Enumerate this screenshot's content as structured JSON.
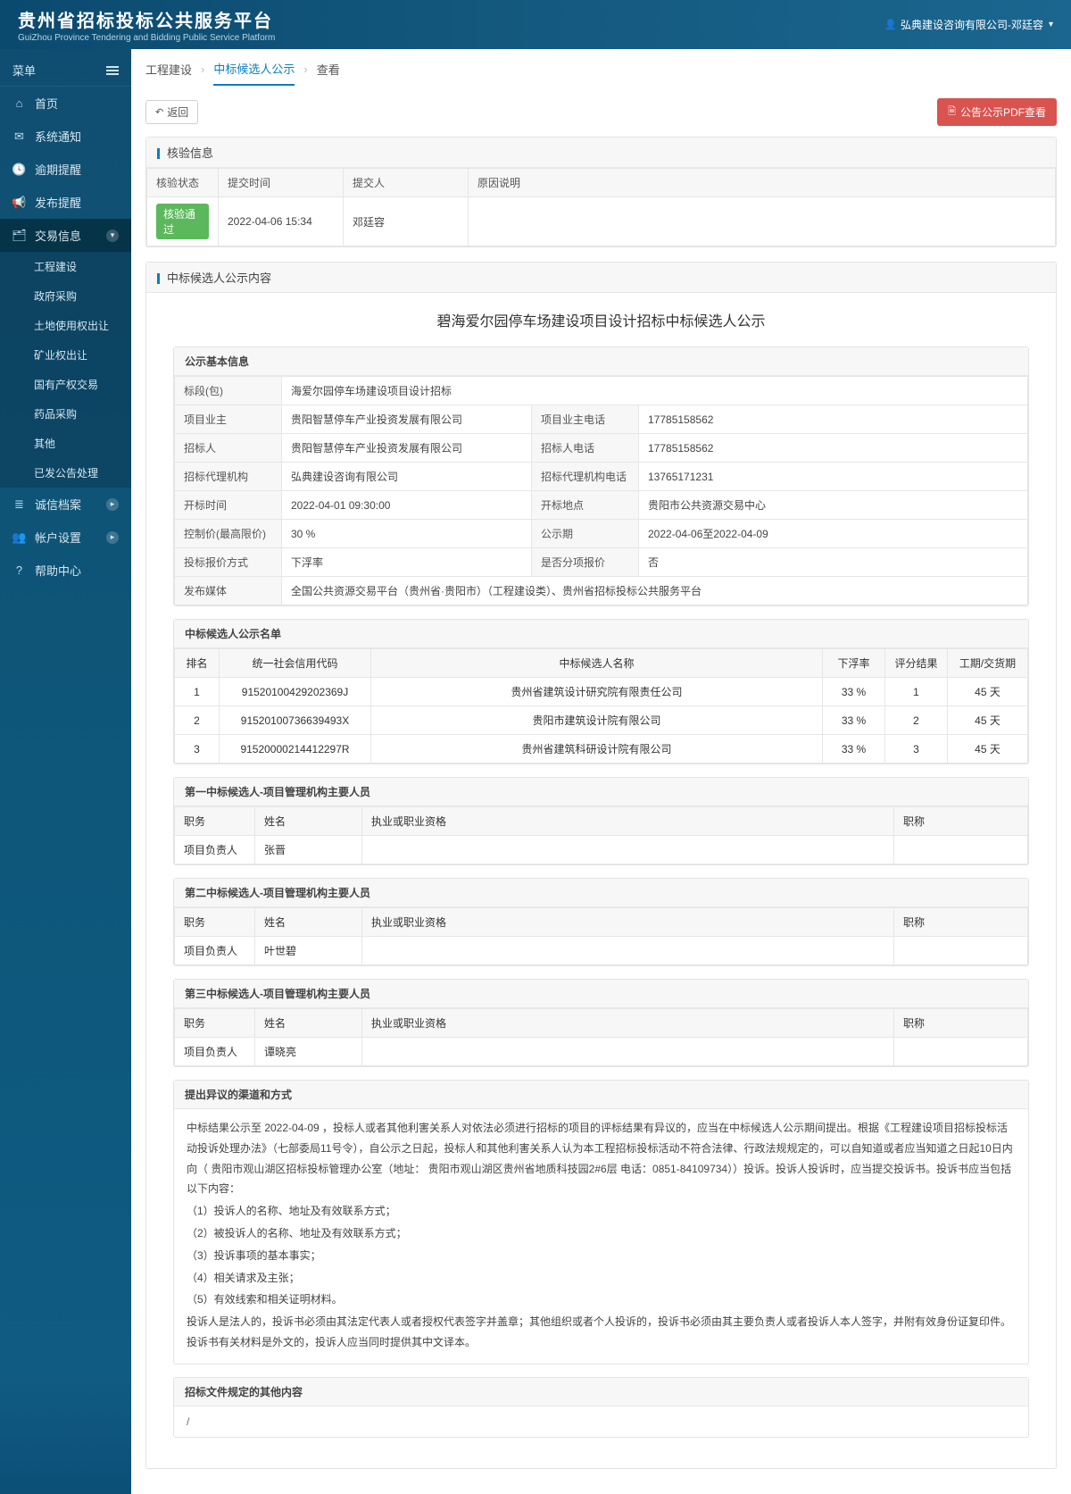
{
  "header": {
    "title_cn": "贵州省招标投标公共服务平台",
    "title_en": "GuiZhou Province Tendering and Bidding Public Service Platform",
    "user": "弘典建设咨询有限公司-邓廷容"
  },
  "sidebar": {
    "menu_label": "菜单",
    "items": [
      {
        "icon": "⌂",
        "label": "首页"
      },
      {
        "icon": "✉",
        "label": "系统通知"
      },
      {
        "icon": "🕓",
        "label": "逾期提醒"
      },
      {
        "icon": "📢",
        "label": "发布提醒"
      },
      {
        "icon": "🗂",
        "label": "交易信息",
        "expandable": true,
        "active": true
      }
    ],
    "sub_items": [
      "工程建设",
      "政府采购",
      "土地使用权出让",
      "矿业权出让",
      "国有产权交易",
      "药品采购",
      "其他",
      "已发公告处理"
    ],
    "items2": [
      {
        "icon": "≣",
        "label": "诚信档案",
        "expandable": true
      },
      {
        "icon": "👥",
        "label": "帐户设置",
        "expandable": true
      },
      {
        "icon": "?",
        "label": "帮助中心"
      }
    ]
  },
  "breadcrumb": {
    "a": "工程建设",
    "b": "中标候选人公示",
    "c": "查看"
  },
  "toolbar": {
    "back": "返回",
    "pdf": "公告公示PDF查看"
  },
  "verify_panel": {
    "title": "核验信息",
    "headers": {
      "status": "核验状态",
      "time": "提交时间",
      "user": "提交人",
      "reason": "原因说明"
    },
    "row": {
      "status": "核验通过",
      "time": "2022-04-06 15:34",
      "user": "邓廷容",
      "reason": ""
    }
  },
  "content_panel": {
    "title": "中标候选人公示内容"
  },
  "doc": {
    "title": "碧海爱尔园停车场建设项目设计招标中标候选人公示"
  },
  "basic": {
    "title": "公示基本信息",
    "labels": {
      "section": "标段(包)",
      "owner": "项目业主",
      "owner_tel": "项目业主电话",
      "tenderer": "招标人",
      "tenderer_tel": "招标人电话",
      "agent": "招标代理机构",
      "agent_tel": "招标代理机构电话",
      "open_time": "开标时间",
      "open_place": "开标地点",
      "ctrl_price": "控制价(最高限价)",
      "period": "公示期",
      "quote_method": "投标报价方式",
      "split": "是否分项报价",
      "media": "发布媒体"
    },
    "values": {
      "section": "海爱尔园停车场建设项目设计招标",
      "owner": "贵阳智慧停车产业投资发展有限公司",
      "owner_tel": "17785158562",
      "tenderer": "贵阳智慧停车产业投资发展有限公司",
      "tenderer_tel": "17785158562",
      "agent": "弘典建设咨询有限公司",
      "agent_tel": "13765171231",
      "open_time": "2022-04-01 09:30:00",
      "open_place": "贵阳市公共资源交易中心",
      "ctrl_price": "30 %",
      "period": "2022-04-06至2022-04-09",
      "quote_method": "下浮率",
      "split": "否",
      "media": "全国公共资源交易平台（贵州省·贵阳市）（工程建设类）、贵州省招标投标公共服务平台"
    }
  },
  "candidates": {
    "title": "中标候选人公示名单",
    "headers": {
      "rank": "排名",
      "code": "统一社会信用代码",
      "name": "中标候选人名称",
      "rate": "下浮率",
      "score": "评分结果",
      "duration": "工期/交货期"
    },
    "rows": [
      {
        "rank": "1",
        "code": "91520100429202369J",
        "name": "贵州省建筑设计研究院有限责任公司",
        "rate": "33 %",
        "score": "1",
        "duration": "45 天"
      },
      {
        "rank": "2",
        "code": "91520100736639493X",
        "name": "贵阳市建筑设计院有限公司",
        "rate": "33 %",
        "score": "2",
        "duration": "45 天"
      },
      {
        "rank": "3",
        "code": "91520000214412297R",
        "name": "贵州省建筑科研设计院有限公司",
        "rate": "33 %",
        "score": "3",
        "duration": "45 天"
      }
    ]
  },
  "personnel_headers": {
    "duty": "职务",
    "name": "姓名",
    "qual": "执业或职业资格",
    "title": "职称"
  },
  "p1": {
    "title": "第一中标候选人-项目管理机构主要人员",
    "duty": "项目负责人",
    "name": "张晋",
    "qual": "",
    "ptitle": ""
  },
  "p2": {
    "title": "第二中标候选人-项目管理机构主要人员",
    "duty": "项目负责人",
    "name": "叶世碧",
    "qual": "",
    "ptitle": ""
  },
  "p3": {
    "title": "第三中标候选人-项目管理机构主要人员",
    "duty": "项目负责人",
    "name": "谭晓亮",
    "qual": "",
    "ptitle": ""
  },
  "objection": {
    "title": "提出异议的渠道和方式",
    "para": "中标结果公示至 2022-04-09 ，投标人或者其他利害关系人对依法必须进行招标的项目的评标结果有异议的，应当在中标候选人公示期间提出。根据《工程建设项目招标投标活动投诉处理办法》（七部委局11号令），自公示之日起，投标人和其他利害关系人认为本工程招标投标活动不符合法律、行政法规规定的，可以自知道或者应当知道之日起10日内向（ 贵阳市观山湖区招标投标管理办公室（地址： 贵阳市观山湖区贵州省地质科技园2#6层 电话：0851-84109734））投诉。投诉人投诉时，应当提交投诉书。投诉书应当包括以下内容：",
    "l1": "（1）投诉人的名称、地址及有效联系方式；",
    "l2": "（2）被投诉人的名称、地址及有效联系方式；",
    "l3": "（3）投诉事项的基本事实；",
    "l4": "（4）相关请求及主张；",
    "l5": "（5）有效线索和相关证明材料。",
    "tail": "投诉人是法人的，投诉书必须由其法定代表人或者授权代表签字并盖章；其他组织或者个人投诉的，投诉书必须由其主要负责人或者投诉人本人签字，并附有效身份证复印件。投诉书有关材料是外文的，投诉人应当同时提供其中文译本。"
  },
  "other": {
    "title": "招标文件规定的其他内容",
    "body": "/"
  }
}
